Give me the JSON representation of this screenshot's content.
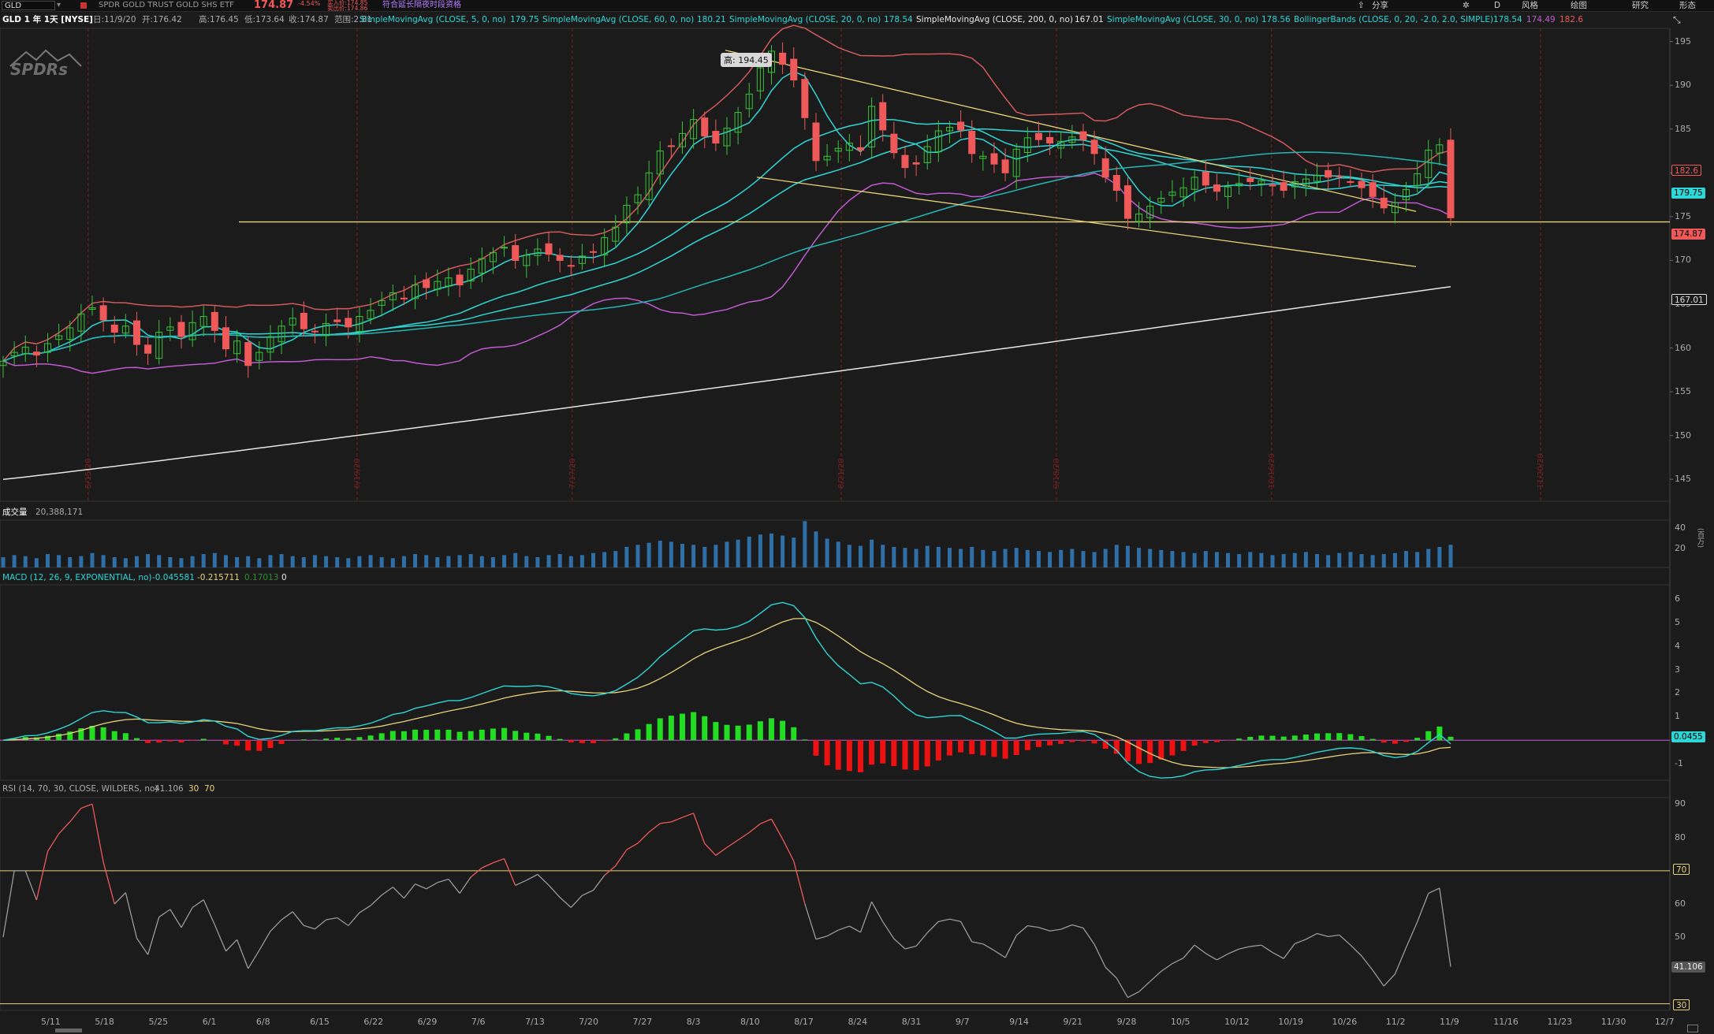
{
  "topbar": {
    "symbol": "GLD",
    "description": "SPDR GOLD TRUST GOLD SHS ETF",
    "last_price": "174.87",
    "change_pct": "-4.54%",
    "bid": "买入价:174.85",
    "ask": "卖出价:174.86",
    "notice": "符合延长隔夜时段资格",
    "tools": [
      "分享",
      "风格",
      "绘图",
      "研究",
      "形态"
    ],
    "d_label": "D"
  },
  "legend": {
    "title": "GLD 1 年 1天 [NYSE]",
    "date": "日:11/9/20",
    "open": "开:176.42",
    "high": "高:176.45",
    "low": "低:173.64",
    "close": "收:174.87",
    "range": "范围:2.81",
    "studies": [
      {
        "label": "SimpleMovingAvg (CLOSE, 5, 0, no)",
        "value": "179.75",
        "color": "#2fd6d6"
      },
      {
        "label": "SimpleMovingAvg (CLOSE, 60, 0, no)",
        "value": "180.21",
        "color": "#2fd6d6"
      },
      {
        "label": "SimpleMovingAvg (CLOSE, 20, 0, no)",
        "value": "178.54",
        "color": "#2fd6d6"
      },
      {
        "label": "SimpleMovingAvg (CLOSE, 200, 0, no)",
        "value": "167.01",
        "color": "#e6e6e6"
      },
      {
        "label": "SimpleMovingAvg (CLOSE, 30, 0, no)",
        "value": "178.56",
        "color": "#2fd6d6"
      }
    ],
    "bollinger": {
      "label": "BollingerBands (CLOSE, 0, 20, -2.0, 2.0, SIMPLE)",
      "mid": "178.54",
      "lower": "174.49",
      "upper": "182.6"
    }
  },
  "price_pane": {
    "logo": "SPDRs",
    "high_callout": "高: 194.45",
    "y_ticks": [
      "195",
      "190",
      "185",
      "180",
      "175",
      "170",
      "165",
      "160",
      "155",
      "150",
      "145"
    ],
    "tags": {
      "upper_band": "182.6",
      "sma5": "179.75",
      "last": "174.87",
      "sma200": "167.01"
    },
    "event_dates": [
      "5/15/20",
      "6/19/20",
      "7/17/20",
      "8/21/20",
      "9/18/20",
      "10/16/20",
      "11/20/20"
    ]
  },
  "volume_pane": {
    "title": "成交量",
    "value": "20,388,171",
    "y_ticks": [
      "40",
      "20"
    ],
    "unit": "(百万)"
  },
  "macd_pane": {
    "title": "MACD (12, 26, 9, EXPONENTIAL, no)",
    "value": "-0.045581",
    "avg": "-0.215711",
    "diff": "0.17013",
    "zero": "0",
    "y_ticks": [
      "6",
      "5",
      "4",
      "3",
      "2",
      "1",
      "-1"
    ],
    "tag": "0.0455"
  },
  "rsi_pane": {
    "title": "RSI (14, 70, 30, CLOSE, WILDERS, no)",
    "value": "41.106",
    "oversold": "30",
    "overbought": "70",
    "y_ticks": [
      "90",
      "80",
      "60",
      "50",
      "40"
    ],
    "tags": {
      "ob": "70",
      "value": "41.106",
      "os": "30"
    }
  },
  "x_axis": [
    "5/11",
    "5/18",
    "5/25",
    "6/1",
    "6/8",
    "6/15",
    "6/22",
    "6/29",
    "7/6",
    "7/13",
    "7/20",
    "7/27",
    "8/3",
    "8/10",
    "8/17",
    "8/24",
    "8/31",
    "9/7",
    "9/14",
    "9/21",
    "9/28",
    "10/5",
    "10/12",
    "10/19",
    "10/26",
    "11/2",
    "11/9",
    "11/16",
    "11/23",
    "11/30",
    "12/7"
  ],
  "colors": {
    "up": "#38c23a",
    "down": "#ef5959",
    "sma": "#2fd6d6",
    "sma200": "#e6e6e6",
    "upper": "#d25a5a",
    "lower": "#c05ad0",
    "trend": "#e8d27a",
    "vol": "#2f6fa8",
    "macd": "#2fd6d6",
    "signal": "#e8d27a",
    "hist_up": "#22dd22",
    "hist_dn": "#ee1111"
  },
  "chart_data": {
    "type": "candlestick",
    "price_closes": [
      158.5,
      159.5,
      160.1,
      159.2,
      160.5,
      161.4,
      162.3,
      163.9,
      164.6,
      163.2,
      161.8,
      162.5,
      160.4,
      159.4,
      161.8,
      162.4,
      161.3,
      162.9,
      163.6,
      162.0,
      159.9,
      160.8,
      158.0,
      159.5,
      161.3,
      162.5,
      163.4,
      162.2,
      161.9,
      162.8,
      163.0,
      162.4,
      163.6,
      164.3,
      165.4,
      166.3,
      165.6,
      167.2,
      166.9,
      167.6,
      168.0,
      167.2,
      169.0,
      170.2,
      170.9,
      171.5,
      170.0,
      170.6,
      171.3,
      170.7,
      170.0,
      169.4,
      170.5,
      171.0,
      172.6,
      173.8,
      176.3,
      177.5,
      180.0,
      182.5,
      183.0,
      184.5,
      186.1,
      184.2,
      183.4,
      185.1,
      186.9,
      189.0,
      192.0,
      193.9,
      192.4,
      190.6,
      186.3,
      181.4,
      181.9,
      182.8,
      183.4,
      182.6,
      187.6,
      184.9,
      182.3,
      180.6,
      181.0,
      183.0,
      184.8,
      185.2,
      184.9,
      182.2,
      181.9,
      181.0,
      180.0,
      182.7,
      184.0,
      183.8,
      183.4,
      183.6,
      184.1,
      183.8,
      182.2,
      179.5,
      178.0,
      174.8,
      175.3,
      176.2,
      177.1,
      177.8,
      178.3,
      179.5,
      178.6,
      177.9,
      178.4,
      178.8,
      179.0,
      179.1,
      178.5,
      178.0,
      179.0,
      179.3,
      179.7,
      179.5,
      179.6,
      179.0,
      178.3,
      177.3,
      176.0,
      176.6,
      178.1,
      179.9,
      182.6,
      183.2,
      174.87
    ],
    "sma200_range": [
      145.0,
      167.01
    ],
    "trendlines": [
      {
        "from": [
          "8/6",
          194.0
        ],
        "to": [
          "11/6",
          175.6
        ]
      },
      {
        "from": [
          "8/11",
          179.5
        ],
        "to": [
          "11/6",
          169.3
        ]
      }
    ],
    "horizontal_line": 174.4,
    "volume_millions": [
      10,
      12,
      11,
      9,
      13,
      12,
      10,
      11,
      14,
      12,
      10,
      9,
      11,
      13,
      12,
      10,
      9,
      11,
      13,
      14,
      12,
      10,
      11,
      9,
      12,
      13,
      11,
      10,
      12,
      11,
      10,
      9,
      11,
      12,
      10,
      9,
      11,
      13,
      12,
      10,
      11,
      12,
      13,
      11,
      10,
      12,
      14,
      11,
      10,
      12,
      13,
      11,
      12,
      14,
      15,
      16,
      20,
      22,
      24,
      26,
      25,
      23,
      22,
      20,
      22,
      25,
      27,
      30,
      32,
      33,
      31,
      29,
      45,
      35,
      28,
      25,
      22,
      21,
      27,
      22,
      20,
      19,
      18,
      21,
      20,
      19,
      18,
      20,
      17,
      16,
      18,
      19,
      17,
      16,
      15,
      17,
      18,
      16,
      15,
      18,
      22,
      21,
      19,
      18,
      17,
      16,
      15,
      14,
      16,
      15,
      14,
      13,
      15,
      14,
      12,
      13,
      14,
      15,
      13,
      12,
      14,
      15,
      13,
      12,
      13,
      14,
      16,
      15,
      18,
      20,
      22
    ],
    "macd": {
      "range": [
        -1.6,
        6.4
      ]
    },
    "rsi": {
      "range": [
        28,
        92
      ],
      "ob": 70,
      "os": 30,
      "last": 41.106
    }
  }
}
